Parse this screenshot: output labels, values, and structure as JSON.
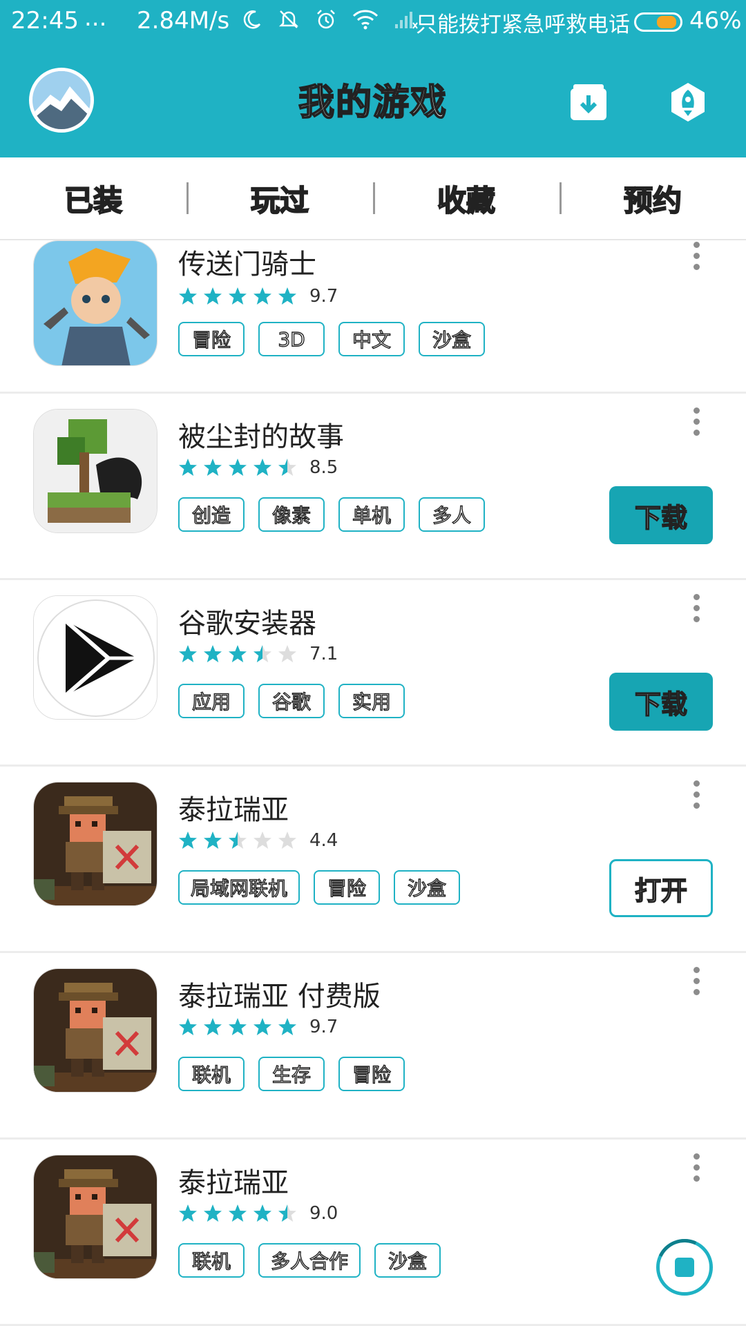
{
  "status_bar": {
    "time": "22:45",
    "dots": "...",
    "speed": "2.84M/s",
    "carrier": "只能拨打紧急呼救电话",
    "battery_percent": "46%",
    "battery_level": 0.46,
    "icons": [
      "moon-icon",
      "mute-icon",
      "alarm-icon",
      "wifi-icon",
      "signal-icon"
    ]
  },
  "header": {
    "title": "我的游戏",
    "background": "#1fb2c4",
    "icons": [
      "avatar",
      "download-manager-icon",
      "rocket-icon"
    ]
  },
  "tabs": [
    {
      "label": "已装"
    },
    {
      "label": "玩过"
    },
    {
      "label": "收藏"
    },
    {
      "label": "预约"
    }
  ],
  "games": [
    {
      "title": "传送门骑士",
      "rating": "9.7",
      "stars": 5,
      "tags": [
        "冒险",
        "3D",
        "中文",
        "沙盒"
      ],
      "action": null
    },
    {
      "title": "被尘封的故事",
      "rating": "8.5",
      "stars": 4.5,
      "tags": [
        "创造",
        "像素",
        "单机",
        "多人"
      ],
      "action": "下载"
    },
    {
      "title": "谷歌安装器",
      "rating": "7.1",
      "stars": 3.5,
      "tags": [
        "应用",
        "谷歌",
        "实用"
      ],
      "action": "下载"
    },
    {
      "title": "泰拉瑞亚",
      "rating": "4.4",
      "stars": 2.5,
      "tags": [
        "局域网联机",
        "冒险",
        "沙盒"
      ],
      "action": "打开"
    },
    {
      "title": "泰拉瑞亚 付费版",
      "rating": "9.7",
      "stars": 5,
      "tags": [
        "联机",
        "生存",
        "冒险"
      ],
      "action": null
    },
    {
      "title": "泰拉瑞亚",
      "rating": "9.0",
      "stars": 4.5,
      "tags": [
        "联机",
        "多人合作",
        "沙盒"
      ],
      "action": null
    }
  ],
  "colors": {
    "accent": "#1fb2c4",
    "button": "#17a5b3",
    "star_on": "#1fb2c4",
    "star_off": "#dddddd"
  }
}
